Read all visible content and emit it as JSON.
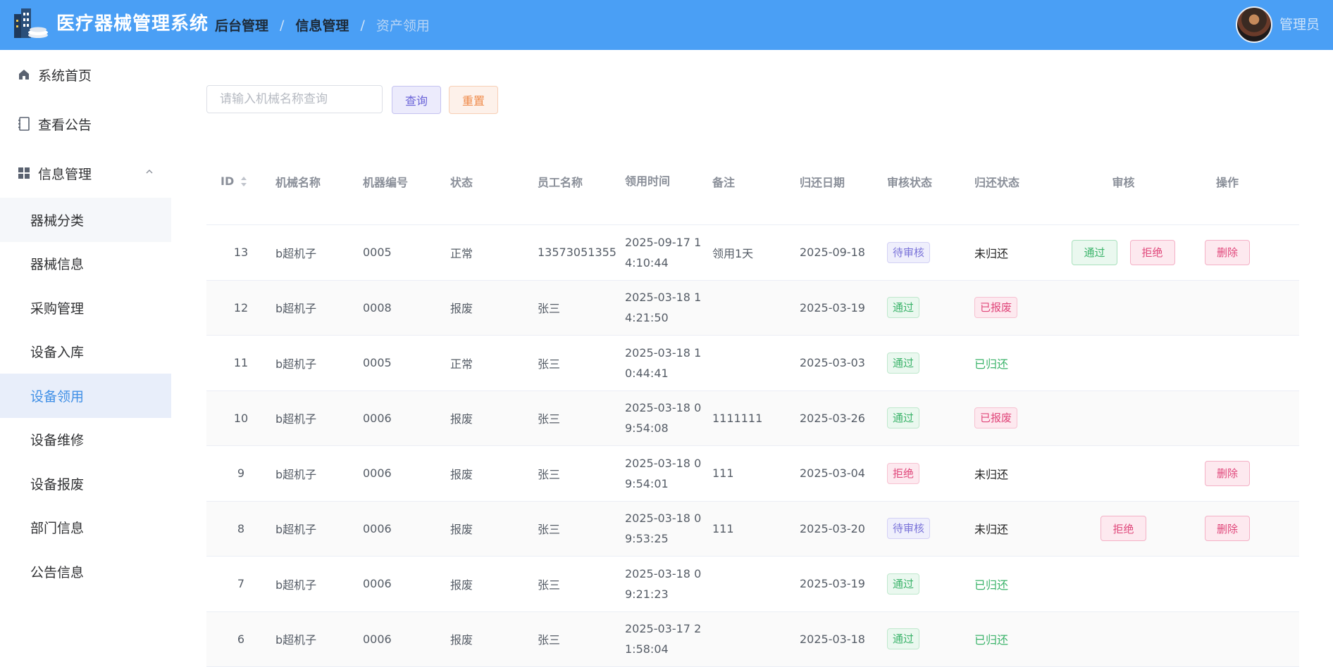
{
  "header": {
    "app_title": "医疗器械管理系统",
    "breadcrumbs": [
      "后台管理",
      "信息管理",
      "资产领用"
    ],
    "user_name": "管理员",
    "color": "#4a9ff5"
  },
  "sidebar": {
    "top_items": [
      {
        "label": "系统首页",
        "icon": "home-icon"
      },
      {
        "label": "查看公告",
        "icon": "notebook-icon"
      },
      {
        "label": "信息管理",
        "icon": "grid-icon"
      }
    ],
    "sub_items": [
      "器械分类",
      "器械信息",
      "采购管理",
      "设备入库",
      "设备领用",
      "设备维修",
      "设备报废",
      "部门信息",
      "公告信息"
    ],
    "active": "设备领用"
  },
  "search": {
    "placeholder": "请输入机械名称查询",
    "query_label": "查询",
    "reset_label": "重置"
  },
  "table": {
    "columns": [
      "ID",
      "机械名称",
      "机器编号",
      "状态",
      "员工名称",
      "领用时间",
      "备注",
      "归还日期",
      "审核状态",
      "归还状态",
      "审核",
      "操作"
    ],
    "pass_label": "通过",
    "reject_label": "拒绝",
    "delete_label": "删除",
    "rows": [
      {
        "id": "13",
        "name": "b超机子",
        "no": "0005",
        "status": "正常",
        "employee": "13573051355",
        "time": "2025-09-17 14:10:44",
        "note": "领用1天",
        "return_date": "2025-09-18",
        "audit": "待审核",
        "return_status": "未归还",
        "actions": [
          "pass",
          "reject"
        ],
        "delete": true
      },
      {
        "id": "12",
        "name": "b超机子",
        "no": "0008",
        "status": "报废",
        "employee": "张三",
        "time": "2025-03-18 14:21:50",
        "note": "",
        "return_date": "2025-03-19",
        "audit": "通过",
        "return_status": "已报废",
        "actions": [],
        "delete": false
      },
      {
        "id": "11",
        "name": "b超机子",
        "no": "0005",
        "status": "正常",
        "employee": "张三",
        "time": "2025-03-18 10:44:41",
        "note": "",
        "return_date": "2025-03-03",
        "audit": "通过",
        "return_status": "已归还",
        "actions": [],
        "delete": false
      },
      {
        "id": "10",
        "name": "b超机子",
        "no": "0006",
        "status": "报废",
        "employee": "张三",
        "time": "2025-03-18 09:54:08",
        "note": "1111111",
        "return_date": "2025-03-26",
        "audit": "通过",
        "return_status": "已报废",
        "actions": [],
        "delete": false
      },
      {
        "id": "9",
        "name": "b超机子",
        "no": "0006",
        "status": "报废",
        "employee": "张三",
        "time": "2025-03-18 09:54:01",
        "note": "111",
        "return_date": "2025-03-04",
        "audit": "拒绝",
        "return_status": "未归还",
        "actions": [],
        "delete": true
      },
      {
        "id": "8",
        "name": "b超机子",
        "no": "0006",
        "status": "报废",
        "employee": "张三",
        "time": "2025-03-18 09:53:25",
        "note": "111",
        "return_date": "2025-03-20",
        "audit": "待审核",
        "return_status": "未归还",
        "actions": [
          "reject"
        ],
        "delete": true
      },
      {
        "id": "7",
        "name": "b超机子",
        "no": "0006",
        "status": "报废",
        "employee": "张三",
        "time": "2025-03-18 09:21:23",
        "note": "",
        "return_date": "2025-03-19",
        "audit": "通过",
        "return_status": "已归还",
        "actions": [],
        "delete": false
      },
      {
        "id": "6",
        "name": "b超机子",
        "no": "0006",
        "status": "报废",
        "employee": "张三",
        "time": "2025-03-17 21:58:04",
        "note": "",
        "return_date": "2025-03-18",
        "audit": "通过",
        "return_status": "已归还",
        "actions": [],
        "delete": false
      }
    ]
  }
}
